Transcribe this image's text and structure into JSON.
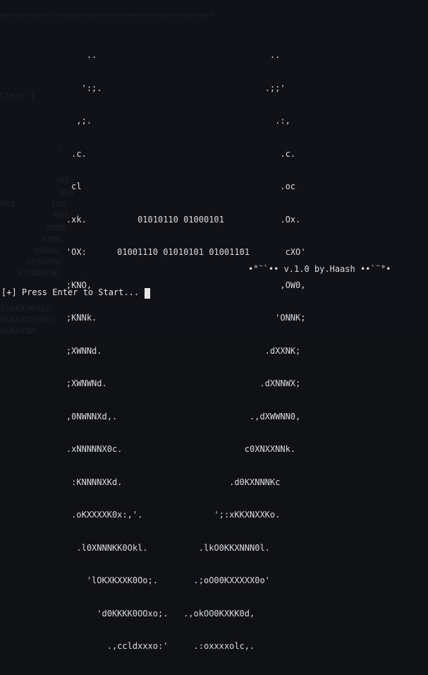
{
  "terminal": {
    "background_ghost_lines": [
      "==========================================",
      "Clear )",
      "",
      "(",
      "",
      "OX:",
      "0OX",
      "000",
      "cX0",
      "0OX",
      "0NNN",
      "XXNN",
      "dXNNN",
      "dXNNXNK",
      "XXXNNKNK",
      "1kKKXNKXko",
      "0KKKXKKBNOl",
      "0kKKXN0"
    ],
    "logo_lines": [
      "                 ..                                  ..",
      "                ':;.                                .;;'",
      "               ,;.                                    .:,",
      "              .c.                                      .c.",
      "              cl                                       .oc",
      "             .xk.          01010110 01000101           .Ox.",
      "             'OX:      01001110 01010101 01001101       cXO'",
      "             ;KNO,                                     ,OW0,",
      "             ;KNNk.                                   'ONNK;",
      "             ;XWNNd.                                .dXXNK;",
      "             ;XWNWNd.                              .dXNNWX;",
      "             ,0NWNNXd,.                          .,dXWWNN0,",
      "             .xNNNNNX0c.                        c0XNXXNNk.",
      "              :KNNNNXKd.                     .d0KXNNNKc",
      "              .oKXXXXK0x:,'.              ';:xKKXNXXKo.",
      "               .l0XNNNKK0Okl.          .lkO0KKXNNN0l.",
      "                 'lOKXKXXK0Oo;.       .;oO00KXXXXX0o'",
      "                   'd0KKKK0OOxo;.   .,okOO0KXKK0d,",
      "                     .,ccldxxxo:'     .:oxxxxolc,.",
      "                           ...             ..."
    ],
    "version_text": "•°¨`•• v.1.0 by.Haash ••`¨°•",
    "prompt_text": "[+] Press Enter to Start..."
  }
}
